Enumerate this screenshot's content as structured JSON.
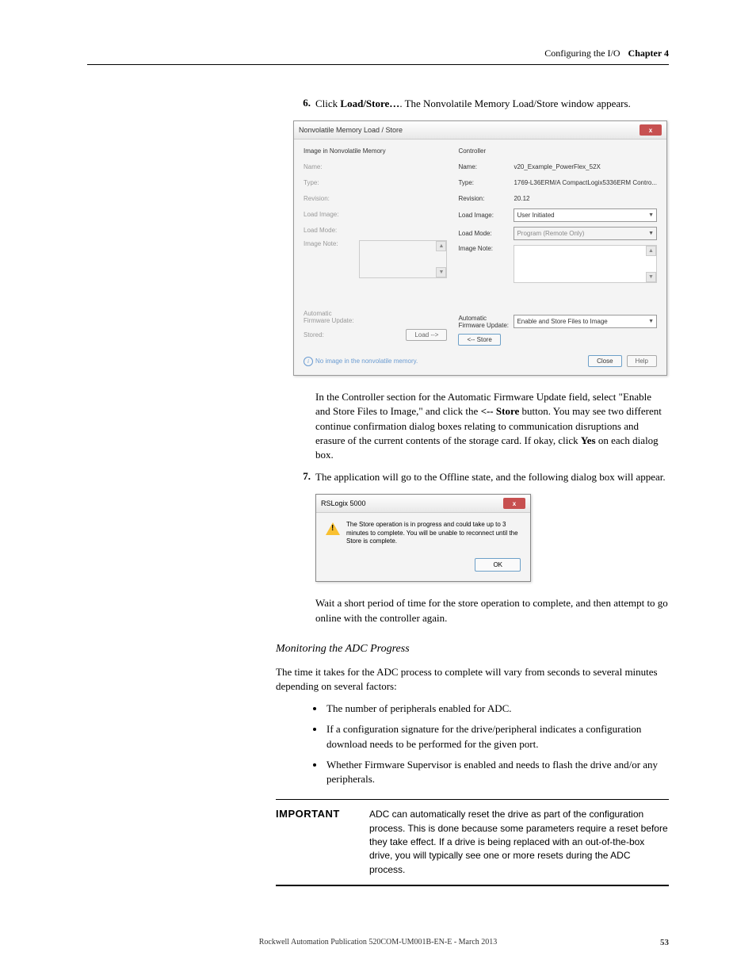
{
  "header": {
    "section": "Configuring the I/O",
    "chapter": "Chapter 4"
  },
  "step6": {
    "num": "6.",
    "pre": "Click ",
    "bold": "Load/Store…",
    "post": ". The Nonvolatile Memory Load/Store window appears."
  },
  "nvm": {
    "title": "Nonvolatile Memory Load / Store",
    "close": "x",
    "left": {
      "heading": "Image in Nonvolatile Memory",
      "name_l": "Name:",
      "type_l": "Type:",
      "rev_l": "Revision:",
      "loadimg_l": "Load Image:",
      "loadmode_l": "Load Mode:",
      "note_l": "Image Note:",
      "afu_l1": "Automatic",
      "afu_l2": "Firmware Update:",
      "stored_l": "Stored:",
      "load_btn": "Load -->"
    },
    "right": {
      "heading": "Controller",
      "name_l": "Name:",
      "name_v": "v20_Example_PowerFlex_52X",
      "type_l": "Type:",
      "type_v": "1769-L36ERM/A CompactLogix5336ERM Contro...",
      "rev_l": "Revision:",
      "rev_v": "20.12",
      "loadimg_l": "Load Image:",
      "loadimg_v": "User Initiated",
      "loadmode_l": "Load Mode:",
      "loadmode_v": "Program (Remote Only)",
      "note_l": "Image Note:",
      "afu_l1": "Automatic",
      "afu_l2": "Firmware Update:",
      "afu_v": "Enable and Store Files to Image",
      "store_btn": "<-- Store"
    },
    "status": "No image in the nonvolatile memory.",
    "close_btn": "Close",
    "help_btn": "Help"
  },
  "para_after_nvm": {
    "p1a": "In the Controller section for the Automatic Firmware Update field, select \"Enable and Store Files to Image,\" and click the ",
    "p1b": "<-- Store",
    "p1c": " button. You may see two different continue confirmation dialog boxes relating to communication disruptions and erasure of the current contents of the storage card. If okay, click ",
    "p1d": "Yes",
    "p1e": " on each dialog box."
  },
  "step7": {
    "num": "7.",
    "text": "The application will go to the Offline state, and the following dialog box will appear."
  },
  "rslogix": {
    "title": "RSLogix 5000",
    "close": "x",
    "msg": "The Store operation is in progress and could take up to 3 minutes to complete.  You will be unable to reconnect until the Store is complete.",
    "ok": "OK"
  },
  "para_after_rs": "Wait a short period of time for the store operation to complete, and then attempt to go online with the controller again.",
  "subheading": "Monitoring the ADC Progress",
  "intro_full": "The time it takes for the ADC process to complete will vary from seconds to several minutes depending on several factors:",
  "bullets": [
    "The number of peripherals enabled for ADC.",
    "If a configuration signature for the drive/peripheral indicates a configuration download needs to be performed for the given port.",
    "Whether Firmware Supervisor is enabled and needs to flash the drive and/or any peripherals."
  ],
  "important": {
    "label": "IMPORTANT",
    "text": "ADC can automatically reset the drive as part of the configuration process. This is done because some parameters require a reset before they take effect. If a drive is being replaced with an out-of-the-box drive, you will typically see one or more resets during the ADC process."
  },
  "footer": {
    "pub": "Rockwell Automation Publication 520COM-UM001B-EN-E - March 2013",
    "page": "53"
  }
}
